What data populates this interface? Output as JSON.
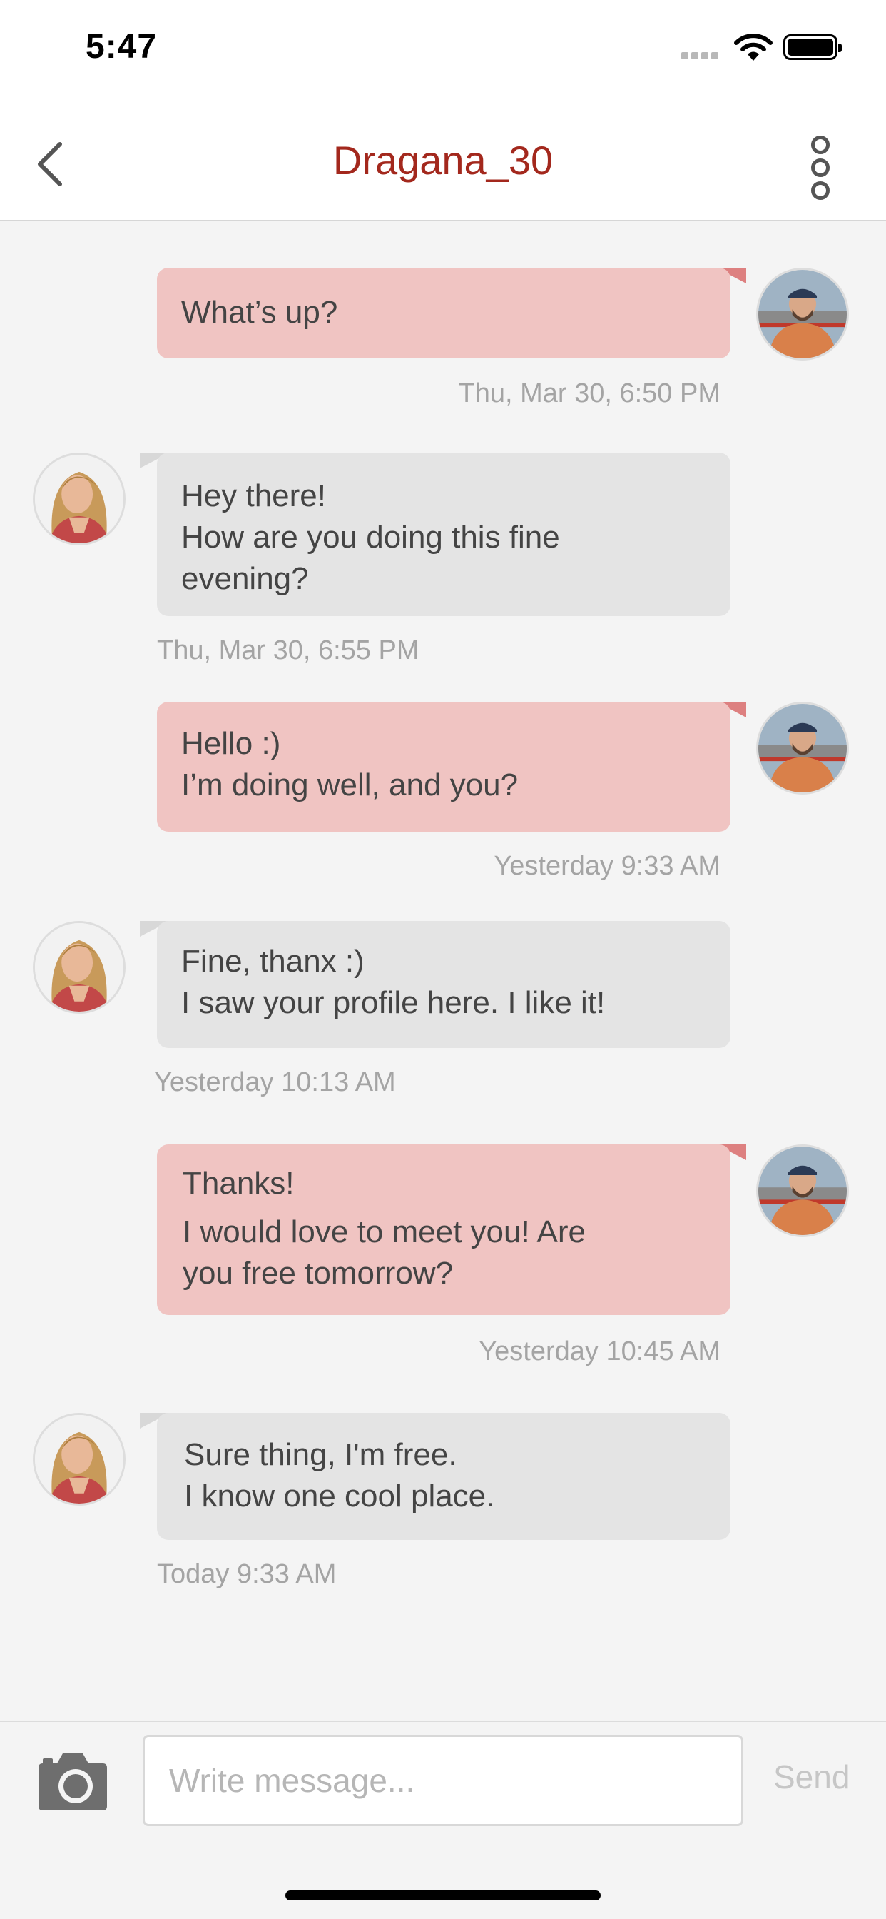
{
  "status_bar": {
    "time": "5:47"
  },
  "header": {
    "title": "Dragana_30"
  },
  "messages": [
    {
      "direction": "out",
      "lines": [
        "What’s up?"
      ],
      "timestamp": "Thu, Mar 30, 6:50 PM"
    },
    {
      "direction": "in",
      "lines": [
        "Hey there!",
        "How are you doing this fine",
        "evening?"
      ],
      "timestamp": "Thu, Mar 30, 6:55 PM"
    },
    {
      "direction": "out",
      "lines": [
        "Hello :)",
        "I’m doing well, and you?"
      ],
      "timestamp": "Yesterday 9:33 AM"
    },
    {
      "direction": "in",
      "lines": [
        "Fine, thanx :)",
        "I saw your profile here. I like it!"
      ],
      "timestamp": "Yesterday 10:13 AM"
    },
    {
      "direction": "out",
      "lines": [
        "Thanks!",
        "I would love to meet you! Are",
        "you free tomorrow?"
      ],
      "timestamp": "Yesterday 10:45 AM"
    },
    {
      "direction": "in",
      "lines": [
        "Sure thing, I'm free.",
        "I know one cool place."
      ],
      "timestamp": "Today 9:33 AM"
    }
  ],
  "composer": {
    "placeholder": "Write message...",
    "send_label": "Send"
  },
  "colors": {
    "accent": "#a3281d",
    "outgoing_bubble": "#f0c4c2",
    "incoming_bubble": "#e4e4e4"
  }
}
